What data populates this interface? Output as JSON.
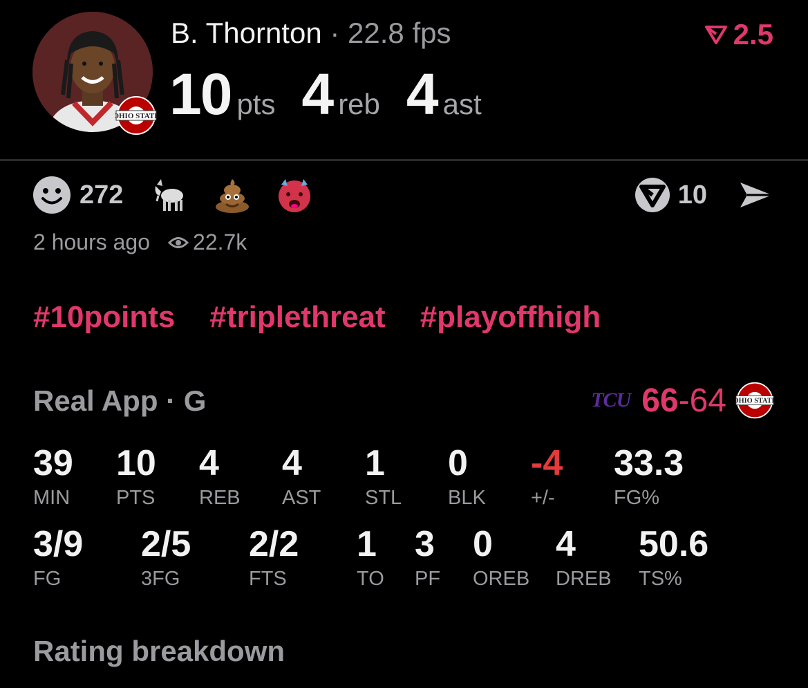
{
  "player": {
    "name": "B. Thornton",
    "fps_text": "22.8 fps",
    "separator": " · ",
    "points": "10",
    "points_unit": "pts",
    "rebounds": "4",
    "rebounds_unit": "reb",
    "assists": "4",
    "assists_unit": "ast",
    "team_logo_text": "OHIO STATE"
  },
  "rating": {
    "value": "2.5",
    "icon": "real-rating-icon"
  },
  "reactions": {
    "smile_count": "272",
    "emojis": [
      "goat-emoji",
      "poop-emoji",
      "hot-devil-emoji"
    ],
    "real_count": "10"
  },
  "meta": {
    "time_ago": "2 hours ago",
    "views": "22.7k"
  },
  "hashtags": [
    "#10points",
    "#triplethreat",
    "#playoffhigh"
  ],
  "game": {
    "title": "Real App · G",
    "opponent": "TCU",
    "score_opponent": "66",
    "score_dash": "-",
    "score_team": "64",
    "team_logo_text": "OHIO STATE"
  },
  "stats_row1": [
    {
      "value": "39",
      "label": "MIN"
    },
    {
      "value": "10",
      "label": "PTS"
    },
    {
      "value": "4",
      "label": "REB"
    },
    {
      "value": "4",
      "label": "AST"
    },
    {
      "value": "1",
      "label": "STL"
    },
    {
      "value": "0",
      "label": "BLK"
    },
    {
      "value": "-4",
      "label": "+/-"
    },
    {
      "value": "33.3",
      "label": "FG%"
    }
  ],
  "stats_row2": [
    {
      "value": "3/9",
      "label": "FG"
    },
    {
      "value": "2/5",
      "label": "3FG"
    },
    {
      "value": "2/2",
      "label": "FTS"
    },
    {
      "value": "1",
      "label": "TO"
    },
    {
      "value": "3",
      "label": "PF"
    },
    {
      "value": "0",
      "label": "OREB"
    },
    {
      "value": "4",
      "label": "DREB"
    },
    {
      "value": "50.6",
      "label": "TS%"
    }
  ],
  "section": {
    "rating_breakdown": "Rating breakdown"
  },
  "colors": {
    "accent": "#e0386a",
    "negative": "#e23b3b",
    "tcu_purple": "#5b2c9e",
    "osu_red": "#bb0000"
  }
}
